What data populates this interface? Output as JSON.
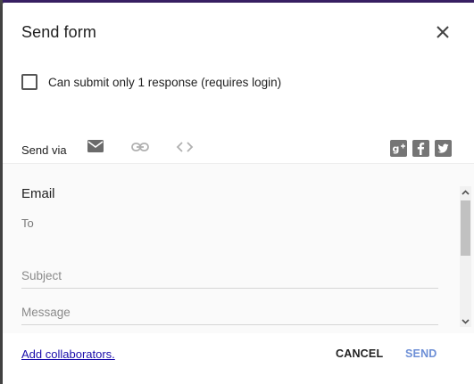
{
  "dialog": {
    "title": "Send form",
    "close_icon": "close-icon"
  },
  "options": {
    "single_response_label": "Can submit only 1 response (requires login)",
    "single_response_checked": false
  },
  "send_via": {
    "label": "Send via",
    "tabs": [
      {
        "id": "email",
        "icon": "email-icon",
        "active": true
      },
      {
        "id": "link",
        "icon": "link-icon",
        "active": false
      },
      {
        "id": "embed",
        "icon": "embed-code-icon",
        "active": false
      }
    ],
    "social": [
      {
        "id": "google-plus",
        "icon": "google-plus-icon"
      },
      {
        "id": "facebook",
        "icon": "facebook-icon"
      },
      {
        "id": "twitter",
        "icon": "twitter-icon"
      }
    ]
  },
  "email": {
    "section_title": "Email",
    "to_label": "To",
    "subject_placeholder": "Subject",
    "message_placeholder": "Message"
  },
  "footer": {
    "add_collaborators": "Add collaborators.",
    "cancel": "CANCEL",
    "send": "SEND"
  },
  "colors": {
    "accent": "#673ab7",
    "send": "#6d8fd6",
    "link": "#1a0dab"
  }
}
